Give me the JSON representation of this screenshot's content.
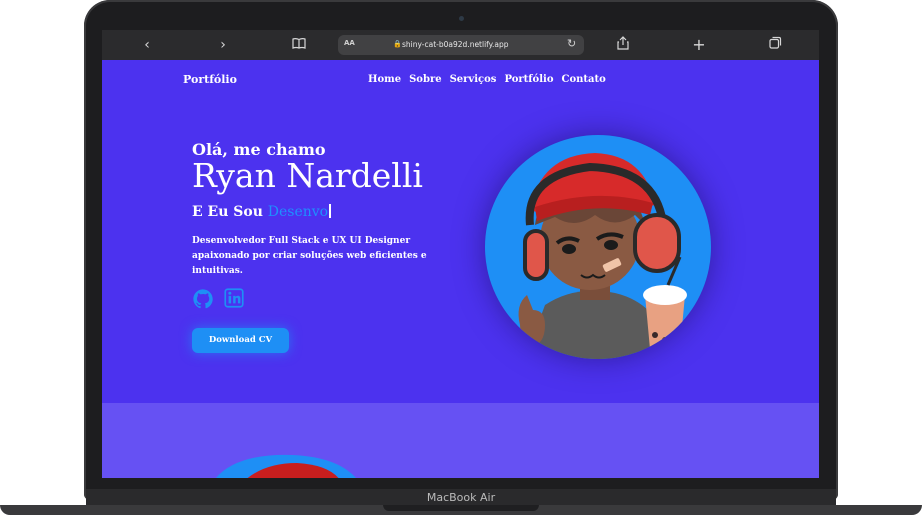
{
  "device": {
    "label": "MacBook Air"
  },
  "browser": {
    "url": "shiny-cat-b0a92d.netlify.app",
    "aa_label": "AA",
    "icons": [
      "back-icon",
      "forward-icon",
      "book-icon",
      "share-icon",
      "plus-icon",
      "tabs-icon",
      "lock-icon",
      "reload-icon"
    ]
  },
  "site": {
    "brand": "Portfólio",
    "menu": [
      "Home",
      "Sobre",
      "Serviços",
      "Portfólio",
      "Contato"
    ],
    "hero": {
      "greeting": "Olá, me chamo",
      "name": "Ryan Nardelli",
      "role_prefix": "E Eu Sou",
      "role_typed": "Desenvo",
      "description": "Desenvolvedor Full Stack e UX UI Designer apaixonado por criar soluções web eficientes e intuitivas.",
      "social": [
        "github-icon",
        "linkedin-icon"
      ],
      "cta": "Download CV"
    },
    "colors": {
      "background": "#4c32ef",
      "accent": "#1e8ff5",
      "section2": "#6651f3"
    }
  }
}
